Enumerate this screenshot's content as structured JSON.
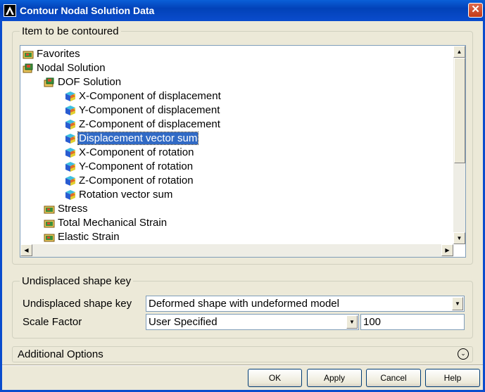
{
  "window": {
    "title": "Contour Nodal Solution Data",
    "close_glyph": "✕"
  },
  "item_group": {
    "legend": "Item to be contoured",
    "tree": [
      {
        "label": "Favorites",
        "icon": "folder-icon",
        "level": 0
      },
      {
        "label": "Nodal Solution",
        "icon": "folder-open-icon",
        "level": 0
      },
      {
        "label": "DOF Solution",
        "icon": "folder-open-icon",
        "level": 1
      },
      {
        "label": "X-Component of displacement",
        "icon": "cube-icon",
        "level": 2
      },
      {
        "label": "Y-Component of displacement",
        "icon": "cube-icon",
        "level": 2
      },
      {
        "label": "Z-Component of displacement",
        "icon": "cube-icon",
        "level": 2
      },
      {
        "label": "Displacement vector sum",
        "icon": "cube-icon",
        "level": 2,
        "selected": true
      },
      {
        "label": "X-Component of rotation",
        "icon": "cube-icon",
        "level": 2
      },
      {
        "label": "Y-Component of rotation",
        "icon": "cube-icon",
        "level": 2
      },
      {
        "label": "Z-Component of rotation",
        "icon": "cube-icon",
        "level": 2
      },
      {
        "label": "Rotation vector sum",
        "icon": "cube-icon",
        "level": 2
      },
      {
        "label": "Stress",
        "icon": "folder-icon",
        "level": 1
      },
      {
        "label": "Total Mechanical Strain",
        "icon": "folder-icon",
        "level": 1
      },
      {
        "label": "Elastic Strain",
        "icon": "folder-icon",
        "level": 1
      }
    ]
  },
  "shape_group": {
    "legend": "Undisplaced shape key",
    "shape_label": "Undisplaced shape key",
    "shape_value": "Deformed shape with undeformed model",
    "scale_label": "Scale Factor",
    "scale_value": "User Specified",
    "scale_number": "100"
  },
  "additional_options": {
    "label": "Additional Options"
  },
  "buttons": {
    "ok": "OK",
    "apply": "Apply",
    "cancel": "Cancel",
    "help": "Help"
  },
  "colors": {
    "title_bar": "#0a4ccd",
    "selection": "#316ac5",
    "dialog_bg": "#ece9d8"
  }
}
